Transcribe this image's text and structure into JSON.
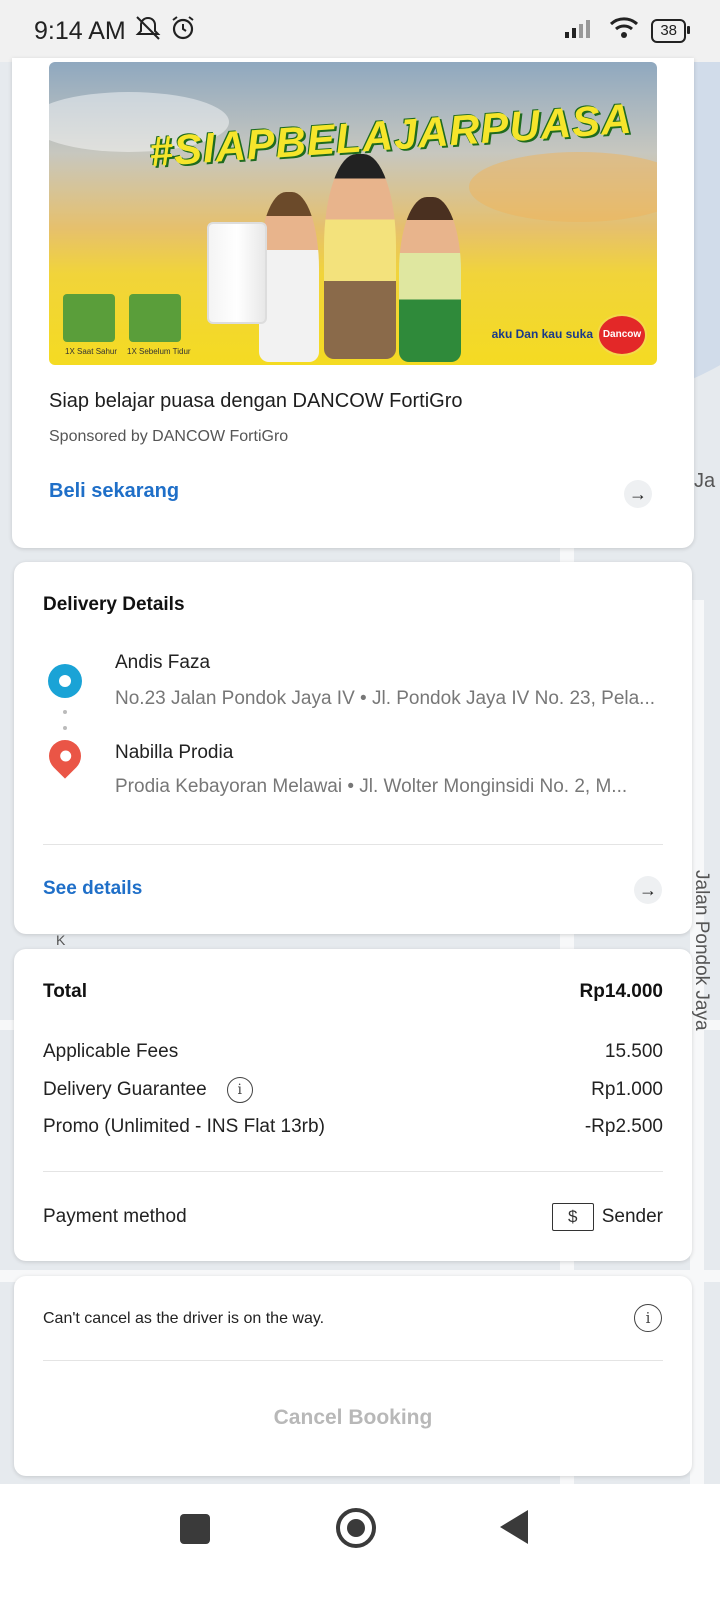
{
  "status_bar": {
    "time": "9:14 AM",
    "icons": [
      "mute-icon",
      "alarm-icon",
      "signal-icon",
      "wifi-icon"
    ],
    "battery": "38"
  },
  "map": {
    "labels": [
      "Jalan Pondok Jaya",
      "Ja",
      "K"
    ]
  },
  "ad": {
    "hashtag": "#SIAPBELAJARPUASA",
    "tile_captions": [
      "1X Saat Sahur",
      "1X Sebelum Tidur"
    ],
    "tagline": "aku Dan kau suka",
    "brand_logo": "Dancow",
    "title": "Siap belajar puasa dengan DANCOW FortiGro",
    "sponsor": "Sponsored by DANCOW FortiGro",
    "cta": "Beli sekarang"
  },
  "delivery": {
    "title": "Delivery Details",
    "origin": {
      "name": "Andis Faza",
      "address": "No.23 Jalan Pondok Jaya IV  •  Jl. Pondok Jaya IV No. 23, Pela..."
    },
    "destination": {
      "name": "Nabilla Prodia",
      "address": "Prodia Kebayoran Melawai  •  Jl. Wolter Monginsidi No. 2, M..."
    },
    "see_details": "See details"
  },
  "payment": {
    "total_label": "Total",
    "total_value": "Rp14.000",
    "fees_label": "Applicable Fees",
    "fees_value": "15.500",
    "guarantee_label": "Delivery Guarantee",
    "guarantee_value": "Rp1.000",
    "promo_label": "Promo (Unlimited - INS Flat 13rb)",
    "promo_value": "-Rp2.500",
    "method_label": "Payment method",
    "method_value": "Sender",
    "cash_symbol": "$"
  },
  "cancel": {
    "note": "Can't cancel as the driver is on the way.",
    "button": "Cancel Booking"
  },
  "colors": {
    "accent_blue": "#1f6fc8",
    "origin_pin": "#1aa3d6",
    "destination_pin": "#ea5546"
  }
}
